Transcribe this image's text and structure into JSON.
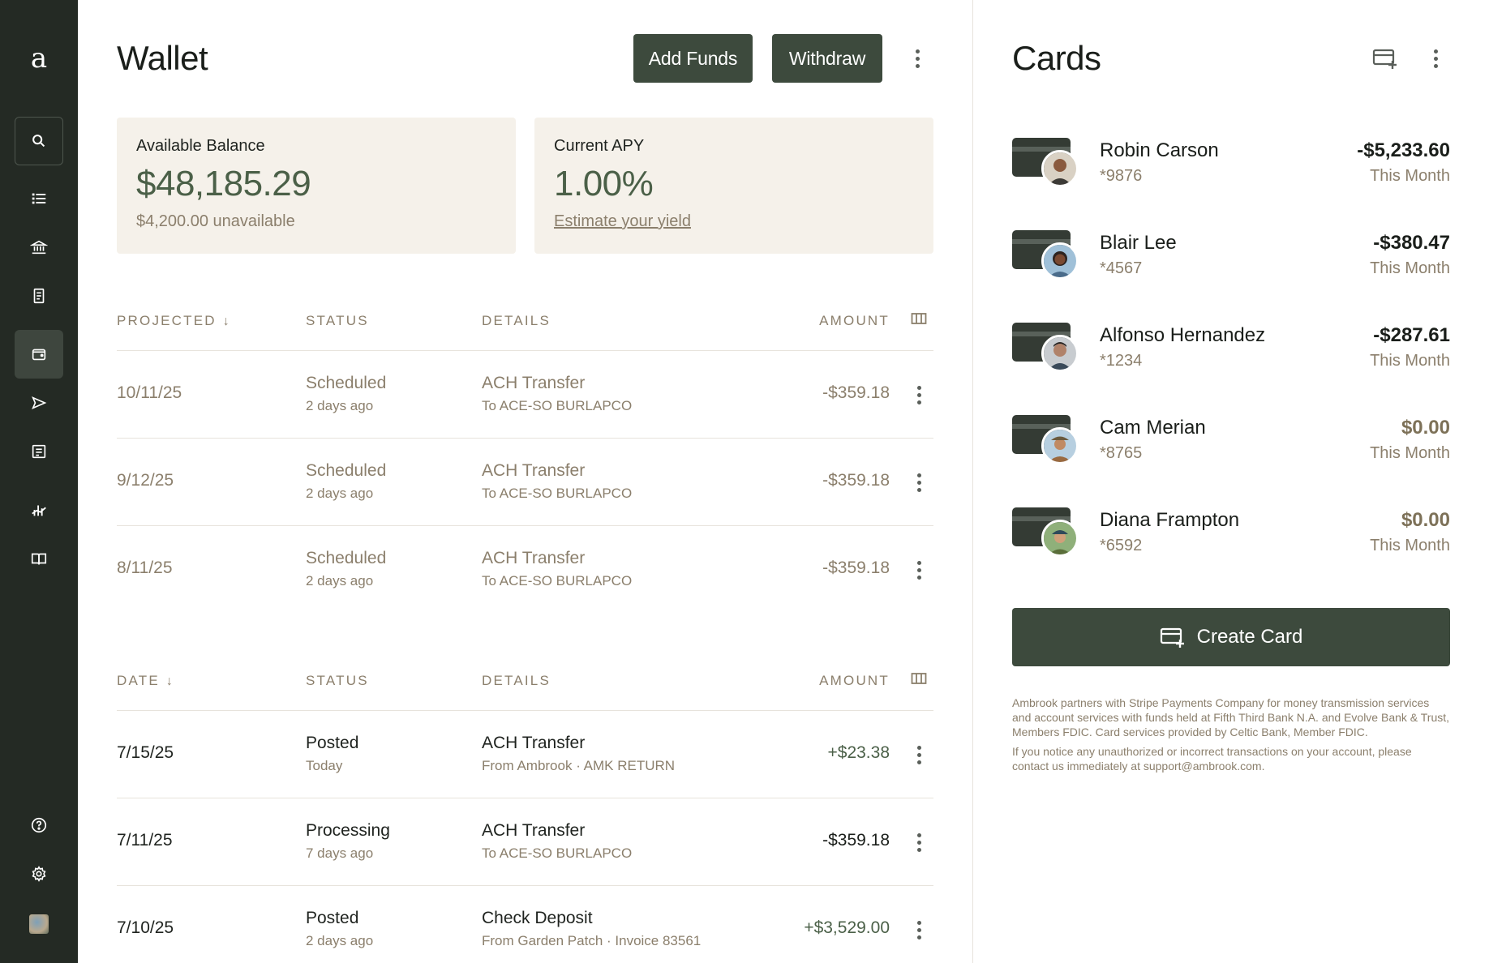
{
  "sidebar": {
    "logo": "a",
    "items": [
      {
        "name": "search",
        "icon": "search-icon"
      },
      {
        "name": "list",
        "icon": "list-icon"
      },
      {
        "name": "bank",
        "icon": "bank-icon"
      },
      {
        "name": "receipt",
        "icon": "receipt-icon"
      },
      {
        "name": "wallet",
        "icon": "wallet-icon",
        "active": true
      },
      {
        "name": "send",
        "icon": "send-icon"
      },
      {
        "name": "invoice",
        "icon": "invoice-icon"
      },
      {
        "name": "reports",
        "icon": "chart-icon"
      },
      {
        "name": "docs",
        "icon": "book-icon"
      },
      {
        "name": "help",
        "icon": "help-icon"
      },
      {
        "name": "settings",
        "icon": "gear-icon"
      },
      {
        "name": "profile",
        "icon": "avatar-icon"
      }
    ]
  },
  "wallet": {
    "title": "Wallet",
    "add_funds_label": "Add Funds",
    "withdraw_label": "Withdraw",
    "balance": {
      "label": "Available Balance",
      "value": "$48,185.29",
      "sub": "$4,200.00 unavailable"
    },
    "apy": {
      "label": "Current APY",
      "value": "1.00%",
      "link": "Estimate your yield"
    }
  },
  "projected": {
    "headers": {
      "date": "PROJECTED",
      "status": "STATUS",
      "details": "DETAILS",
      "amount": "AMOUNT"
    },
    "rows": [
      {
        "date": "10/11/25",
        "status": "Scheduled",
        "status_sub": "2 days ago",
        "detail": "ACH Transfer",
        "detail_sub": "To ACE-SO BURLAPCO",
        "amount": "-$359.18"
      },
      {
        "date": "9/12/25",
        "status": "Scheduled",
        "status_sub": "2 days ago",
        "detail": "ACH Transfer",
        "detail_sub": "To ACE-SO BURLAPCO",
        "amount": "-$359.18"
      },
      {
        "date": "8/11/25",
        "status": "Scheduled",
        "status_sub": "2 days ago",
        "detail": "ACH Transfer",
        "detail_sub": "To ACE-SO BURLAPCO",
        "amount": "-$359.18"
      }
    ]
  },
  "history": {
    "headers": {
      "date": "DATE",
      "status": "STATUS",
      "details": "DETAILS",
      "amount": "AMOUNT"
    },
    "rows": [
      {
        "date": "7/15/25",
        "status": "Posted",
        "status_sub": "Today",
        "detail": "ACH Transfer",
        "detail_sub": "From Ambrook · AMK RETURN",
        "amount": "+$23.38"
      },
      {
        "date": "7/11/25",
        "status": "Processing",
        "status_sub": "7 days ago",
        "detail": "ACH Transfer",
        "detail_sub": "To ACE-SO BURLAPCO",
        "amount": "-$359.18"
      },
      {
        "date": "7/10/25",
        "status": "Posted",
        "status_sub": "2 days ago",
        "detail": "Check Deposit",
        "detail_sub": "From Garden Patch · Invoice 83561",
        "amount": "+$3,529.00"
      }
    ]
  },
  "cards": {
    "title": "Cards",
    "items": [
      {
        "name": "Robin Carson",
        "number": "*9876",
        "amount": "-$5,233.60",
        "period": "This Month"
      },
      {
        "name": "Blair Lee",
        "number": "*4567",
        "amount": "-$380.47",
        "period": "This Month"
      },
      {
        "name": "Alfonso Hernandez",
        "number": "*1234",
        "amount": "-$287.61",
        "period": "This Month"
      },
      {
        "name": "Cam Merian",
        "number": "*8765",
        "amount": "$0.00",
        "period": "This Month"
      },
      {
        "name": "Diana Frampton",
        "number": "*6592",
        "amount": "$0.00",
        "period": "This Month"
      }
    ],
    "create_label": "Create Card",
    "disclaimer_1": "Ambrook partners with Stripe Payments Company for money transmission services and account services with funds held at Fifth Third Bank N.A. and Evolve Bank & Trust, Members FDIC. Card services provided by Celtic Bank, Member FDIC.",
    "disclaimer_2": "If you notice any unauthorized or incorrect transactions on your account, please contact us immediately at support@ambrook.com."
  },
  "colors": {
    "sidebar_bg": "#242a24",
    "button_bg": "#3d4a3d",
    "accent_green": "#4b6048",
    "muted_text": "#8b7f6c",
    "card_bg": "#f5f1ea"
  }
}
